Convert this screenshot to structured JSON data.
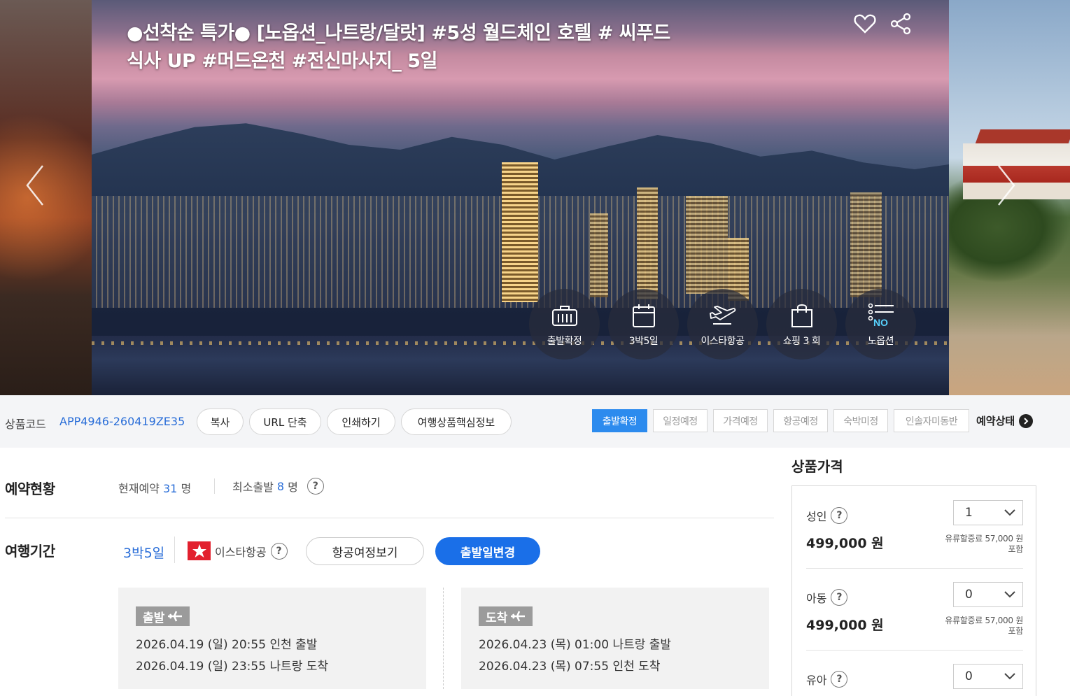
{
  "hero": {
    "title": "●선착순 특가● [노옵션_나트랑/달랏] #5성 월드체인 호텔 # 씨푸드 식사 UP #머드온천 #전신마사지_ 5일",
    "badges": [
      {
        "icon": "suitcase-icon",
        "label": "출발확정"
      },
      {
        "icon": "calendar-icon",
        "label": "3박5일"
      },
      {
        "icon": "airplane-icon",
        "label": "이스타항공"
      },
      {
        "icon": "shopping-bag-icon",
        "label": "쇼핑 3 회"
      },
      {
        "icon": "no-option-icon",
        "label": "노옵션"
      }
    ]
  },
  "info_bar": {
    "code_label": "상품코드",
    "code_value": "APP4946-260419ZE35",
    "buttons": [
      "복사",
      "URL 단축",
      "인쇄하기",
      "여행상품핵심정보"
    ],
    "status_tags": [
      {
        "label": "출발확정",
        "active": true
      },
      {
        "label": "일정예정",
        "active": false
      },
      {
        "label": "가격예정",
        "active": false
      },
      {
        "label": "항공예정",
        "active": false
      },
      {
        "label": "숙박미정",
        "active": false
      },
      {
        "label": "인솔자미동반",
        "active": false
      }
    ],
    "status_link": "예약상태"
  },
  "reservation": {
    "title": "예약현황",
    "current_label": "현재예약",
    "current_count": "31",
    "current_unit": "명",
    "min_label": "최소출발",
    "min_count": "8",
    "min_unit": "명"
  },
  "period": {
    "title": "여행기간",
    "duration": "3박5일",
    "airline": "이스타항공",
    "flight_info_button": "항공여정보기",
    "change_date_button": "출발일변경"
  },
  "departure": {
    "tag": "출발",
    "line1": "2026.04.19 (일) 20:55 인천 출발",
    "line2": "2026.04.19 (일) 23:55 나트랑 도착"
  },
  "arrival": {
    "tag": "도착",
    "line1": "2026.04.23 (목) 01:00 나트랑 출발",
    "line2": "2026.04.23 (목) 07:55 인천 도착"
  },
  "price": {
    "title": "상품가격",
    "rows": [
      {
        "label": "성인",
        "qty": "1",
        "price": "499,000 원",
        "note1": "유류할증료 57,000 원",
        "note2": "포함"
      },
      {
        "label": "아동",
        "qty": "0",
        "price": "499,000 원",
        "note1": "유류할증료 57,000 원",
        "note2": "포함"
      },
      {
        "label": "유아",
        "qty": "0"
      }
    ]
  },
  "colors": {
    "accent": "#1a6fe8",
    "link": "#2a6ed8",
    "tag_active": "#2c8bee"
  }
}
